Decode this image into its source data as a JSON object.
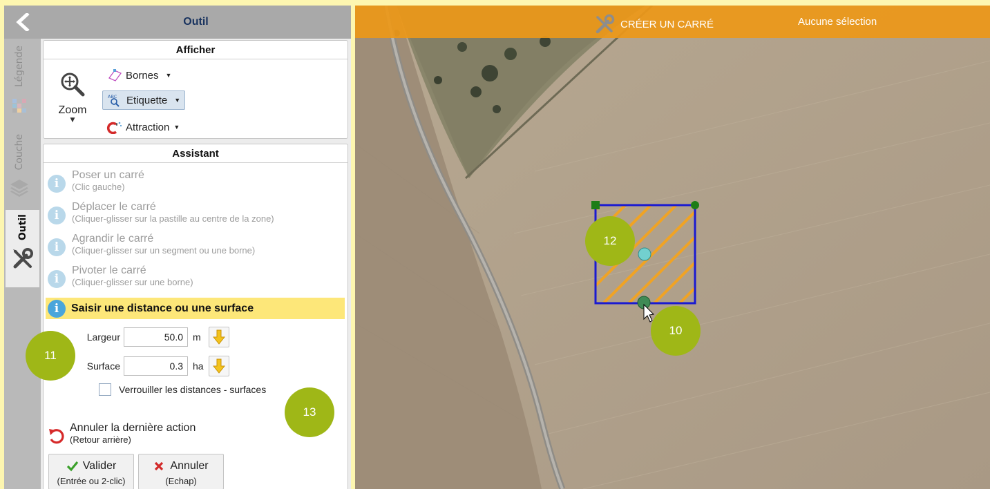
{
  "sidebar": {
    "back_icon": "chevron-left-icon",
    "tabs": [
      {
        "label": "Légende",
        "icon": "legend-grid-icon",
        "active": false
      },
      {
        "label": "Couche",
        "icon": "layers-icon",
        "active": false
      },
      {
        "label": "Outil",
        "icon": "tools-icon",
        "active": true
      }
    ]
  },
  "panel": {
    "title": "Outil",
    "afficher": {
      "title": "Afficher",
      "zoom_label": "Zoom",
      "tools": [
        {
          "label": "Bornes",
          "icon": "vertices-icon"
        },
        {
          "label": "Etiquette",
          "icon": "label-search-icon",
          "selected": true
        },
        {
          "label": "Attraction",
          "icon": "magnet-icon"
        }
      ]
    },
    "assistant": {
      "title": "Assistant",
      "steps": [
        {
          "title": "Poser un carré",
          "subtitle": "(Clic gauche)"
        },
        {
          "title": "Déplacer le carré",
          "subtitle": "(Cliquer-glisser sur la pastille au centre de la zone)"
        },
        {
          "title": "Agrandir le carré",
          "subtitle": "(Cliquer-glisser sur un segment ou une borne)"
        },
        {
          "title": "Pivoter le carré",
          "subtitle": "(Cliquer-glisser sur une borne)"
        }
      ],
      "active_step": "Saisir une distance ou une surface",
      "largeur": {
        "label": "Largeur",
        "value": "50.0",
        "unit": "m"
      },
      "surface": {
        "label": "Surface",
        "value": "0.3",
        "unit": "ha"
      },
      "lock": {
        "label": "Verrouiller les distances - surfaces",
        "checked": false
      },
      "undo": {
        "label": "Annuler la dernière action",
        "hint": "(Retour arrière)"
      },
      "valider": {
        "label": "Valider",
        "hint": "(Entrée ou 2-clic)"
      },
      "annuler": {
        "label": "Annuler",
        "hint": "(Echap)"
      }
    }
  },
  "map": {
    "toolbar_title": "CRÉER UN CARRÉ",
    "selection_status": "Aucune sélection",
    "accent_color": "#ec9819",
    "shape_color": "#1a1ad1"
  },
  "callouts": [
    "11",
    "12",
    "10",
    "13"
  ],
  "colors": {
    "highlight_yellow": "#fde779",
    "info_blue": "#4aa5db",
    "callout_green": "#9fb717"
  }
}
